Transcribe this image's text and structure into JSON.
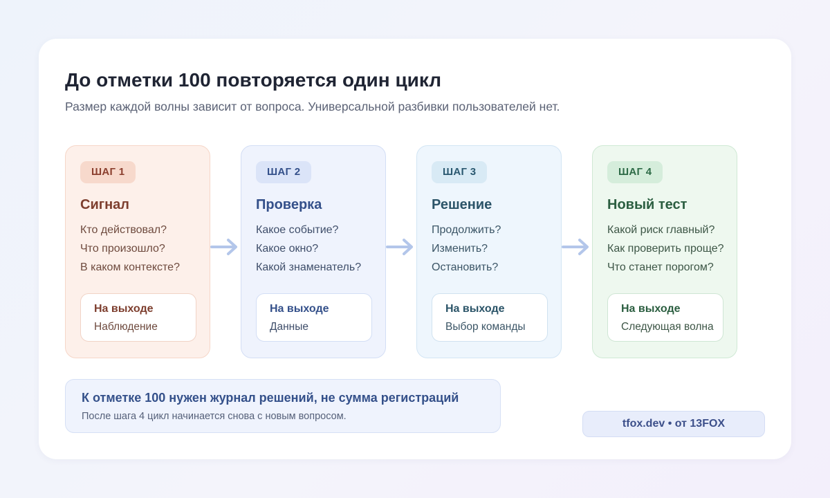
{
  "header": {
    "title": "До отметки 100 повторяется один цикл",
    "subtitle": "Размер каждой волны зависит от вопроса. Универсальной разбивки пользователей нет."
  },
  "colors": {
    "arrow": "#b3c6ea",
    "step1": "#fdf0ea",
    "step2": "#eff3fd",
    "step3": "#eef6fd",
    "step4": "#eef8ef"
  },
  "steps": [
    {
      "badge": "ШАГ 1",
      "title": "Сигнал",
      "questions": [
        "Кто действовал?",
        "Что произошло?",
        "В каком контексте?"
      ],
      "output_label": "На выходе",
      "output_value": "Наблюдение"
    },
    {
      "badge": "ШАГ 2",
      "title": "Проверка",
      "questions": [
        "Какое событие?",
        "Какое окно?",
        "Какой знаменатель?"
      ],
      "output_label": "На выходе",
      "output_value": "Данные"
    },
    {
      "badge": "ШАГ 3",
      "title": "Решение",
      "questions": [
        "Продолжить?",
        "Изменить?",
        "Остановить?"
      ],
      "output_label": "На выходе",
      "output_value": "Выбор команды"
    },
    {
      "badge": "ШАГ 4",
      "title": "Новый тест",
      "questions": [
        "Какой риск главный?",
        "Как проверить проще?",
        "Что станет порогом?"
      ],
      "output_label": "На выходе",
      "output_value": "Следующая волна"
    }
  ],
  "note": {
    "title": "К отметке 100 нужен журнал решений, не сумма регистраций",
    "text": "После шага 4 цикл начинается снова с новым вопросом."
  },
  "credit": "tfox.dev • от 13FOX"
}
